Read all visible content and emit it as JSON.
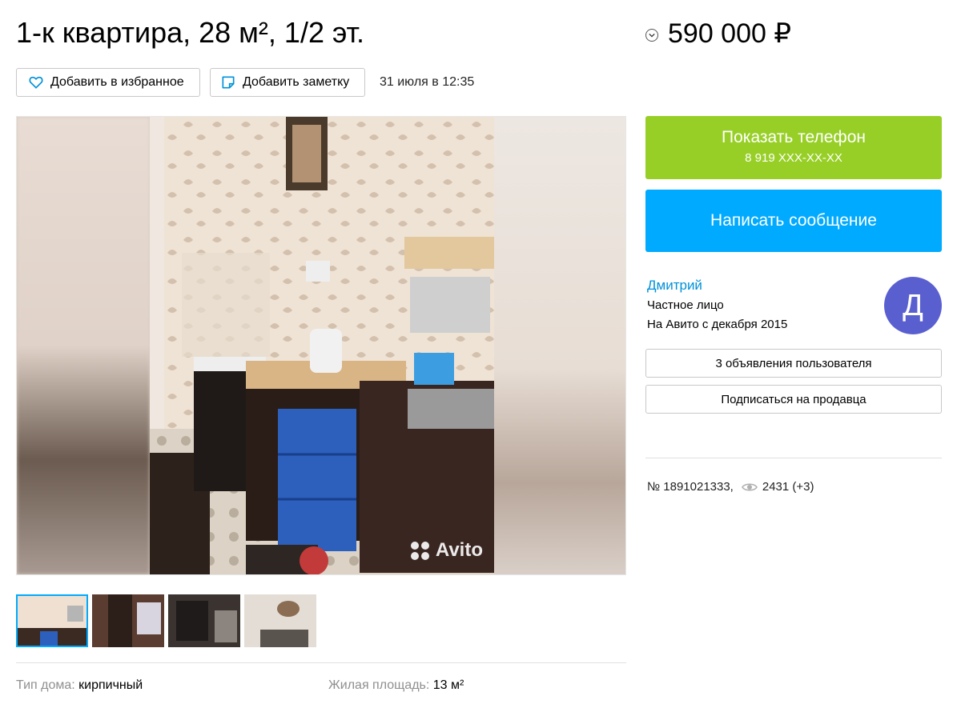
{
  "listing": {
    "title": "1-к квартира, 28 м², 1/2 эт.",
    "price": "590 000 ₽",
    "date": "31 июля в 12:35",
    "favorite_label": "Добавить в избранное",
    "note_label": "Добавить заметку",
    "watermark": "Avito",
    "thumbnails": [
      "kitchen",
      "hallway",
      "room-dark",
      "room-light"
    ],
    "params": [
      {
        "label": "Тип дома: ",
        "value": "кирпичный"
      },
      {
        "label": "Жилая площадь: ",
        "value": "13 м²"
      }
    ]
  },
  "contact": {
    "show_phone_label": "Показать телефон",
    "phone_masked": "8 919 XXX-XX-XX",
    "message_label": "Написать сообщение"
  },
  "seller": {
    "name": "Дмитрий",
    "type": "Частное лицо",
    "since": "На Авито с декабря 2015",
    "avatar_letter": "Д",
    "ads_label": "3 объявления пользователя",
    "subscribe_label": "Подписаться на продавца"
  },
  "stats": {
    "item_number": "№ 1891021333,",
    "views": "2431 (+3)"
  },
  "colors": {
    "phone_button": "#97cf26",
    "message_button": "#00aaff",
    "seller_link": "#0091d9",
    "avatar": "#5a5fd0",
    "active_thumb_border": "#00aaff"
  },
  "icons": [
    "heart-icon",
    "note-icon",
    "chevron-down-icon",
    "eye-icon",
    "avito-logo"
  ]
}
